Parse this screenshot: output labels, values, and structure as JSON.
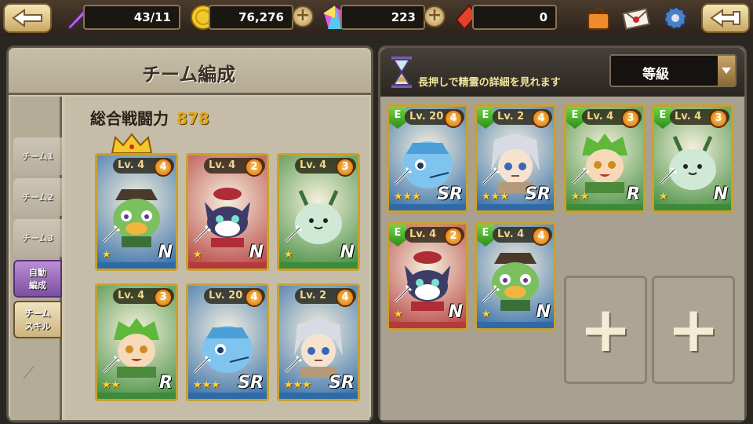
{
  "topbar": {
    "stamina": "43/11",
    "gold": "76,276",
    "gems": "223",
    "crystals": "0"
  },
  "team_panel": {
    "title": "チーム編成",
    "power_label": "総合戦闘力",
    "power_value": "878",
    "tabs": [
      {
        "label": "チーム1"
      },
      {
        "label": "チーム2"
      },
      {
        "label": "チーム3"
      },
      {
        "label": "自動\n編成"
      },
      {
        "label": "チーム\nスキル"
      }
    ],
    "cards": [
      {
        "level": "Lv. 4",
        "rank": "4",
        "grade": "N",
        "stars": "★",
        "char": "duck",
        "border": "#c9a12e",
        "bg": "#2f6aa8"
      },
      {
        "level": "Lv. 4",
        "rank": "2",
        "grade": "N",
        "stars": "★",
        "char": "cat",
        "border": "#c9a12e",
        "bg": "#b43b3b"
      },
      {
        "level": "Lv. 4",
        "rank": "3",
        "grade": "N",
        "stars": "★",
        "char": "blob",
        "border": "#c9a12e",
        "bg": "#3d8a3a"
      },
      {
        "level": "Lv. 4",
        "rank": "3",
        "grade": "R",
        "stars": "★★",
        "char": "boy",
        "border": "#c9a12e",
        "bg": "#3d8a3a"
      },
      {
        "level": "Lv. 20",
        "rank": "4",
        "grade": "SR",
        "stars": "★★★",
        "char": "fish",
        "border": "#c9a12e",
        "bg": "#2f6aa8"
      },
      {
        "level": "Lv. 2",
        "rank": "4",
        "grade": "SR",
        "stars": "★★★",
        "char": "girl",
        "border": "#c9a12e",
        "bg": "#2f6aa8"
      }
    ]
  },
  "collection_panel": {
    "hint": "長押しで精霊の詳細を見れます",
    "sort_label": "等級",
    "cards": [
      {
        "equip": "E",
        "level": "Lv. 20",
        "rank": "4",
        "grade": "SR",
        "stars": "★★★",
        "char": "fish",
        "bg": "#2f6aa8"
      },
      {
        "equip": "E",
        "level": "Lv. 2",
        "rank": "4",
        "grade": "SR",
        "stars": "★★★",
        "char": "girl",
        "bg": "#2f6aa8"
      },
      {
        "equip": "E",
        "level": "Lv. 4",
        "rank": "3",
        "grade": "R",
        "stars": "★★",
        "char": "boy",
        "bg": "#3d8a3a"
      },
      {
        "equip": "E",
        "level": "Lv. 4",
        "rank": "3",
        "grade": "N",
        "stars": "★",
        "char": "blob",
        "bg": "#3d8a3a"
      },
      {
        "equip": "E",
        "level": "Lv. 4",
        "rank": "2",
        "grade": "N",
        "stars": "★",
        "char": "cat",
        "bg": "#b43b3b"
      },
      {
        "equip": "E",
        "level": "Lv. 4",
        "rank": "4",
        "grade": "N",
        "stars": "★",
        "char": "duck",
        "bg": "#2f6aa8"
      }
    ]
  }
}
